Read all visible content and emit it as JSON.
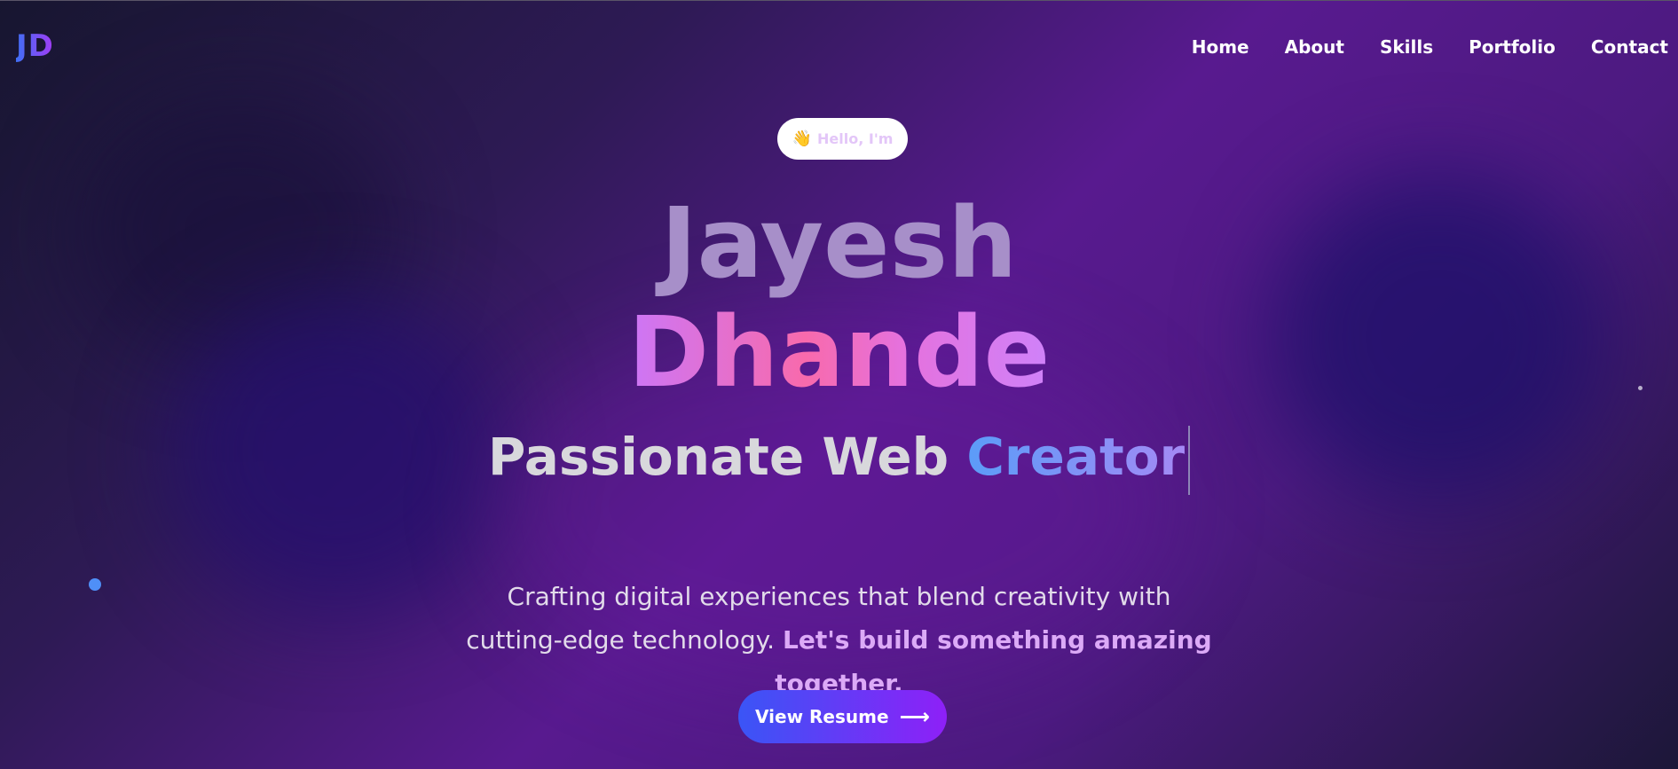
{
  "brand": {
    "logo_text": "JD"
  },
  "nav": {
    "items": [
      {
        "label": "Home"
      },
      {
        "label": "About"
      },
      {
        "label": "Skills"
      },
      {
        "label": "Portfolio"
      },
      {
        "label": "Contact"
      }
    ]
  },
  "hero": {
    "badge": {
      "icon": "waving-hand-icon",
      "emoji": "👋",
      "text": "Hello, I'm"
    },
    "first_name": "Jayesh",
    "last_name": "Dhande",
    "tagline_static": "Passionate Web",
    "tagline_accent": "Creator",
    "description_plain": "Crafting digital experiences that blend creativity with cutting-edge technology.",
    "description_highlight": "Let's build something amazing together.",
    "cta": {
      "label": "View Resume",
      "icon": "arrow-right-icon",
      "glyph": "⟶"
    }
  },
  "colors": {
    "accent_blue": "#3a55f6",
    "accent_purple": "#8e20f7",
    "name_gradient_pink": "#f86aac",
    "highlight_text": "#dcaaf7"
  }
}
